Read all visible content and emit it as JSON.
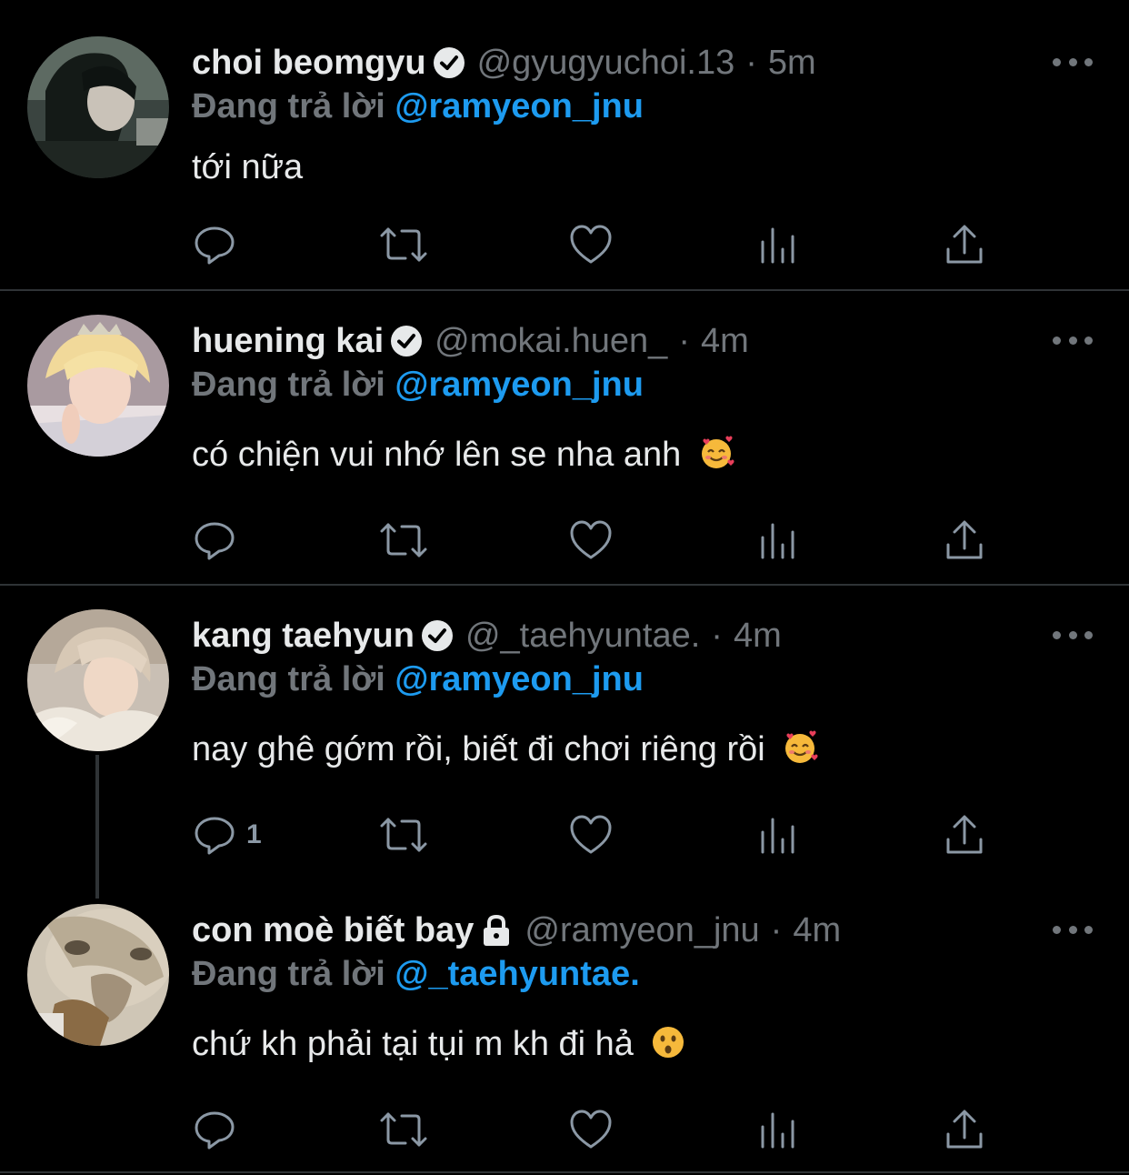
{
  "tweets": [
    {
      "name": "choi beomgyu",
      "verified": true,
      "handle": "@gyugyuchoi.13",
      "separator": "·",
      "time": "5m",
      "reply_label": "Đang trả lời",
      "reply_to": "@ramyeon_jnu",
      "text": "tới nữa",
      "emoji": "",
      "reply_count": ""
    },
    {
      "name": "huening kai",
      "verified": true,
      "handle": "@mokai.huen_",
      "separator": "·",
      "time": "4m",
      "reply_label": "Đang trả lời",
      "reply_to": "@ramyeon_jnu",
      "text": "có chiện vui nhớ lên se nha anh",
      "emoji": "smiling-face-with-hearts",
      "reply_count": ""
    },
    {
      "name": "kang taehyun",
      "verified": true,
      "handle": "@_taehyuntae.",
      "separator": "·",
      "time": "4m",
      "reply_label": "Đang trả lời",
      "reply_to": "@ramyeon_jnu",
      "text": "nay ghê gớm rồi, biết đi chơi riêng rồi",
      "emoji": "smiling-face-with-hearts",
      "reply_count": "1"
    },
    {
      "name": "con moè biết bay",
      "verified": false,
      "protected": true,
      "handle": "@ramyeon_jnu",
      "separator": "·",
      "time": "4m",
      "reply_label": "Đang trả lời",
      "reply_to": "@_taehyuntae.",
      "text": "chứ kh phải tại tụi m kh đi hả",
      "emoji": "hushed-face",
      "reply_count": ""
    }
  ],
  "icons": {
    "reply": "reply-icon",
    "retweet": "retweet-icon",
    "like": "like-icon",
    "views": "views-icon",
    "share": "share-icon",
    "more": "more-icon",
    "verified": "verified-badge-icon",
    "protected": "lock-icon"
  },
  "colors": {
    "background": "#000000",
    "text": "#e7e9ea",
    "secondary": "#71767b",
    "link": "#1d9bf0",
    "divider": "#2f3336"
  }
}
